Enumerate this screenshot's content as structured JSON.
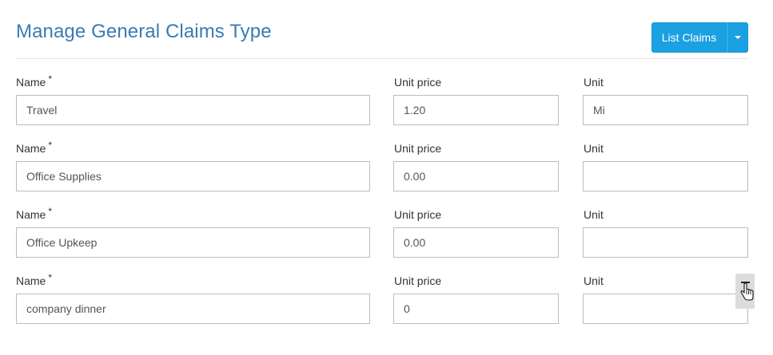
{
  "page": {
    "title": "Manage General Claims Type"
  },
  "toolbar": {
    "list_claims_label": "List Claims",
    "dropdown_icon": "caret-down-icon"
  },
  "form": {
    "required_mark": "*",
    "rows": [
      {
        "name_label": "Name",
        "price_label": "Unit price",
        "unit_label": "Unit",
        "name": "Travel",
        "unit_price": "1.20",
        "unit": "Mi"
      },
      {
        "name_label": "Name",
        "price_label": "Unit price",
        "unit_label": "Unit",
        "name": "Office Supplies",
        "unit_price": "0.00",
        "unit": ""
      },
      {
        "name_label": "Name",
        "price_label": "Unit price",
        "unit_label": "Unit",
        "name": "Office Upkeep",
        "unit_price": "0.00",
        "unit": ""
      },
      {
        "name_label": "Name",
        "price_label": "Unit price",
        "unit_label": "Unit",
        "name": "company dinner",
        "unit_price": "0",
        "unit": ""
      }
    ]
  },
  "colors": {
    "title": "#3a7bb4",
    "accent_button": "#1ba1e2"
  },
  "icons": {
    "remove_handle": "remove-row-icon",
    "cursor": "hand-pointer-icon"
  }
}
